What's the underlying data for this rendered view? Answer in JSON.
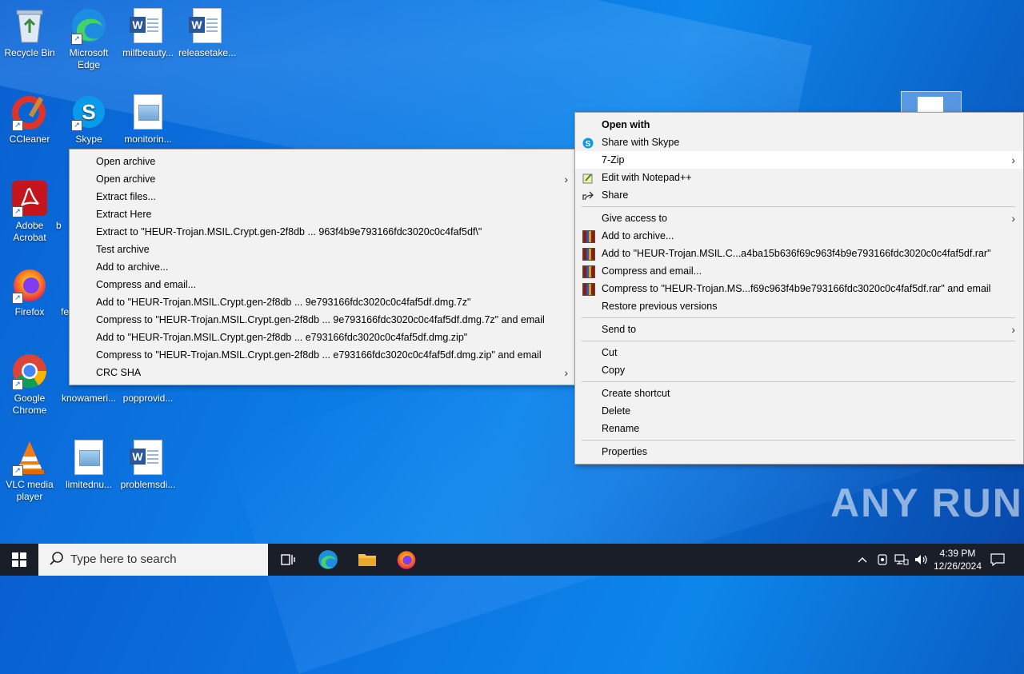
{
  "desktop_icons": [
    {
      "label": "Recycle Bin"
    },
    {
      "label": "Microsoft Edge"
    },
    {
      "label": "milfbeauty..."
    },
    {
      "label": "releasetake..."
    },
    {
      "label": "CCleaner"
    },
    {
      "label": "Skype"
    },
    {
      "label": "monitorin..."
    },
    {
      "label": "Adobe Acrobat"
    },
    {
      "label": "b"
    },
    {
      "label": "Firefox"
    },
    {
      "label": "fe"
    },
    {
      "label": "Google Chrome"
    },
    {
      "label": "knowameri..."
    },
    {
      "label": "popprovid..."
    },
    {
      "label": "VLC media player"
    },
    {
      "label": "limitednu..."
    },
    {
      "label": "problemsdi..."
    }
  ],
  "submenu_7zip": [
    "Open archive",
    "Open archive",
    "Extract files...",
    "Extract Here",
    "Extract to \"HEUR-Trojan.MSIL.Crypt.gen-2f8db ... 963f4b9e793166fdc3020c0c4faf5df\\\"",
    "Test archive",
    "Add to archive...",
    "Compress and email...",
    "Add to \"HEUR-Trojan.MSIL.Crypt.gen-2f8db ... 9e793166fdc3020c0c4faf5df.dmg.7z\"",
    "Compress to \"HEUR-Trojan.MSIL.Crypt.gen-2f8db ... 9e793166fdc3020c0c4faf5df.dmg.7z\" and email",
    "Add to \"HEUR-Trojan.MSIL.Crypt.gen-2f8db ... e793166fdc3020c0c4faf5df.dmg.zip\"",
    "Compress to \"HEUR-Trojan.MSIL.Crypt.gen-2f8db ... e793166fdc3020c0c4faf5df.dmg.zip\" and email",
    "CRC SHA"
  ],
  "context_menu": {
    "open_with": "Open with",
    "share_skype": "Share with Skype",
    "seven_zip": "7-Zip",
    "edit_notepad": "Edit with Notepad++",
    "share": "Share",
    "give_access": "Give access to",
    "add_archive": "Add to archive...",
    "add_rar": "Add to \"HEUR-Trojan.MSIL.C...a4ba15b636f69c963f4b9e793166fdc3020c0c4faf5df.rar\"",
    "compress_email": "Compress and email...",
    "compress_rar_email": "Compress to \"HEUR-Trojan.MS...f69c963f4b9e793166fdc3020c0c4faf5df.rar\" and email",
    "restore": "Restore previous versions",
    "send_to": "Send to",
    "cut": "Cut",
    "copy": "Copy",
    "create_shortcut": "Create shortcut",
    "delete": "Delete",
    "rename": "Rename",
    "properties": "Properties"
  },
  "taskbar": {
    "search_placeholder": "Type here to search",
    "time": "4:39 PM",
    "date": "12/26/2024"
  },
  "watermark": "ANY RUN",
  "colors": {
    "desktop_bg": "#0b74e0",
    "taskbar_bg": "#1a1e29",
    "menu_bg": "#f2f2f2"
  }
}
